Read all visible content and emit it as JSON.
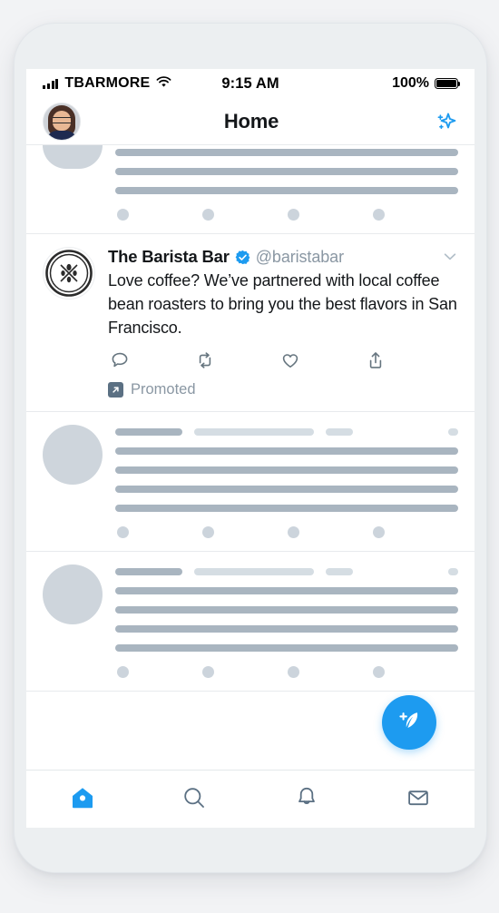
{
  "theme": {
    "accent": "#1d9bf0",
    "text_primary": "#14171a",
    "text_muted": "#8a97a3",
    "skeleton_dark": "#a9b5c0",
    "skeleton_light": "#d5dde3",
    "page_bg": "#f2f3f5",
    "card_bg": "#ffffff",
    "promoted_icon_bg": "#5b7083"
  },
  "status_bar": {
    "carrier": "TBARMORE",
    "time": "9:15 AM",
    "battery_percent": "100%",
    "signal_icon": "signal-bars-icon",
    "wifi_icon": "wifi-icon",
    "battery_icon": "battery-full-icon"
  },
  "header": {
    "title": "Home",
    "avatar_name": "profile-avatar",
    "sparkle_icon": "sparkle-icon"
  },
  "feed": {
    "skeleton_top": {
      "lines": 3,
      "action_dots": 4,
      "clipped": true
    },
    "promoted_tweet": {
      "display_name": "The Barista Bar",
      "handle": "@baristabar",
      "verified": true,
      "verified_icon": "verified-badge-icon",
      "chevron_icon": "chevron-down-icon",
      "body": "Love coffee? We’ve partnered with local coffee bean roasters to bring you the best flavors in San Francisco.",
      "avatar_icon": "barista-bar-logo",
      "actions": [
        {
          "name": "reply-icon",
          "label": "Reply"
        },
        {
          "name": "retweet-icon",
          "label": "Retweet"
        },
        {
          "name": "like-icon",
          "label": "Like"
        },
        {
          "name": "share-icon",
          "label": "Share"
        }
      ],
      "promoted_label": "Promoted",
      "promoted_icon": "promoted-arrow-icon"
    },
    "skeleton_rows": [
      {
        "meta_bars": 3,
        "lines": 4,
        "action_dots": 4
      },
      {
        "meta_bars": 3,
        "lines": 4,
        "action_dots": 4
      }
    ]
  },
  "compose_button": {
    "icon": "compose-feather-icon",
    "label": "Compose"
  },
  "tabbar": {
    "items": [
      {
        "name": "tab-home",
        "icon": "home-icon",
        "label": "Home",
        "active": true
      },
      {
        "name": "tab-search",
        "icon": "search-icon",
        "label": "Search",
        "active": false
      },
      {
        "name": "tab-notifications",
        "icon": "bell-icon",
        "label": "Notifications",
        "active": false
      },
      {
        "name": "tab-messages",
        "icon": "mail-icon",
        "label": "Messages",
        "active": false
      }
    ]
  }
}
